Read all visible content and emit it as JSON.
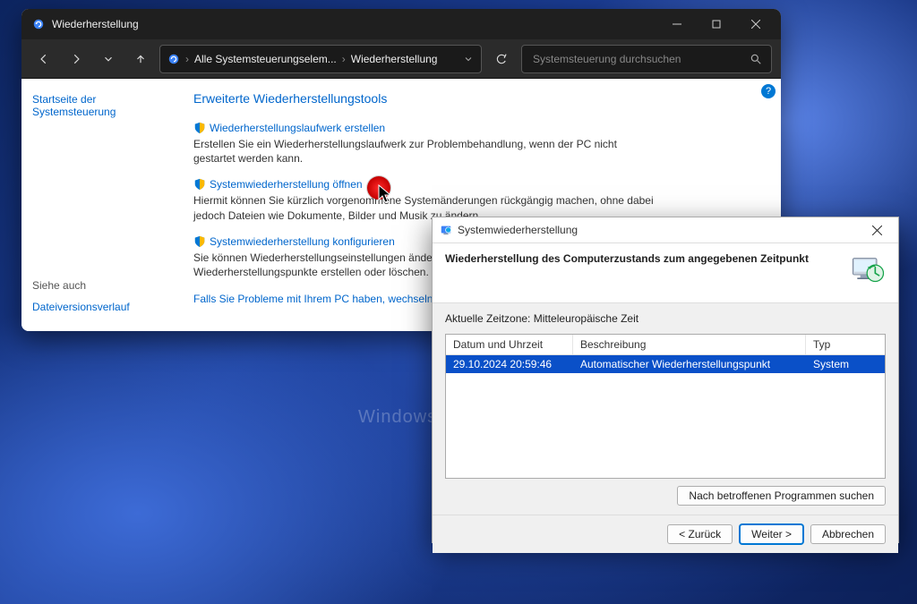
{
  "cp": {
    "title": "Wiederherstellung",
    "breadcrumbs": [
      "Alle Systemsteuerungselem...",
      "Wiederherstellung"
    ],
    "search_placeholder": "Systemsteuerung durchsuchen",
    "sidebar": {
      "home_link": "Startseite der Systemsteuerung",
      "see_also_label": "Siehe auch",
      "see_also_link": "Dateiversionsverlauf"
    },
    "heading": "Erweiterte Wiederherstellungstools",
    "tools": [
      {
        "link": "Wiederherstellungslaufwerk erstellen",
        "desc": "Erstellen Sie ein Wiederherstellungslaufwerk zur Problembehandlung, wenn der PC nicht gestartet werden kann."
      },
      {
        "link": "Systemwiederherstellung öffnen",
        "desc": "Hiermit können Sie kürzlich vorgenommene Systemänderungen rückgängig machen, ohne dabei jedoch Dateien wie Dokumente, Bilder und Musik zu ändern."
      },
      {
        "link": "Systemwiederherstellung konfigurieren",
        "desc": "Sie können Wiederherstellungseinstellungen ändern, Speicherplatz verwalten und Wiederherstellungspunkte erstellen oder löschen."
      }
    ],
    "footer_link": "Falls Sie Probleme mit Ihrem PC haben, wechseln Sie zu \"Einstellungen\", und versuchen Sie, ihn zurückzusetzen."
  },
  "sr": {
    "title": "Systemwiederherstellung",
    "header": "Wiederherstellung des Computerzustands zum angegebenen Zeitpunkt",
    "tz_label": "Aktuelle Zeitzone: Mitteleuropäische Zeit",
    "columns": {
      "datetime": "Datum und Uhrzeit",
      "description": "Beschreibung",
      "type": "Typ"
    },
    "rows": [
      {
        "datetime": "29.10.2024 20:59:46",
        "description": "Automatischer Wiederherstellungspunkt",
        "type": "System"
      }
    ],
    "scan_button": "Nach betroffenen Programmen suchen",
    "buttons": {
      "back": "< Zurück",
      "next": "Weiter >",
      "cancel": "Abbrechen"
    }
  },
  "watermark": "Windows-FAQ"
}
